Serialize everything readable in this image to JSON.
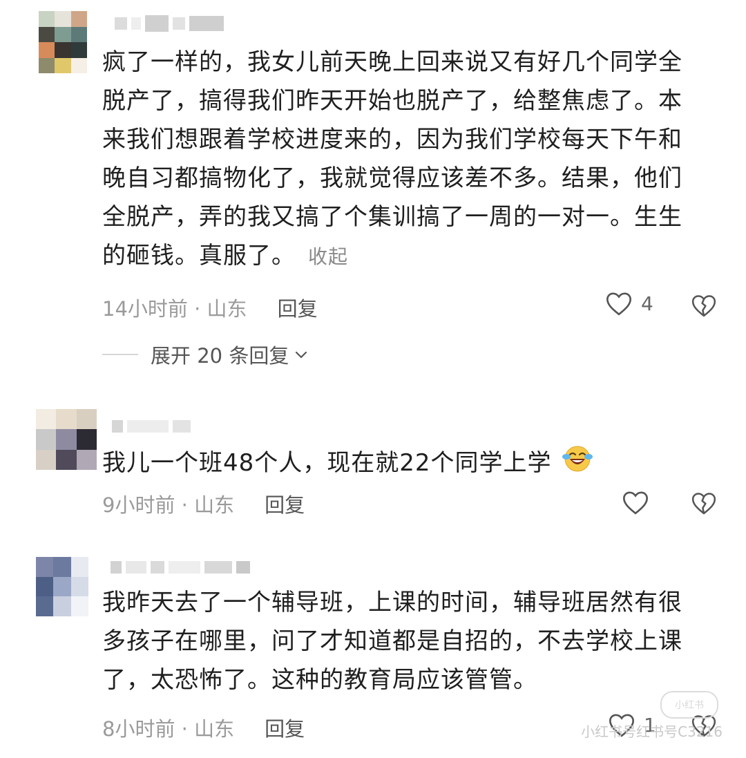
{
  "comments": [
    {
      "text": "疯了一样的，我女儿前天晚上回来说又有好几个同学全脱产了，搞得我们昨天开始也脱产了，给整焦虑了。本来我们想跟着学校进度来的，因为我们学校每天下午和晚自习都搞物化了，我就觉得应该差不多。结果，他们全脱产，弄的我又搞了个集训搞了一周的一对一。生生的砸钱。真服了。",
      "lines": [
        "疯了一样的，我女儿前天晚上回来说又有好几个同学全",
        "脱产了，搞得我们昨天开始也脱产了，给整焦虑了。本",
        "来我们想跟着学校进度来的，因为我们学校每天下午和",
        "晚自习都搞物化了，我就觉得应该差不多。结果，他们",
        "全脱产，弄的我又搞了个集训搞了一周的一对一。生生",
        "的砸钱。真服了。"
      ],
      "fold_label": "收起",
      "time": "14小时前",
      "location": "山东",
      "meta": "14小时前 · 山东",
      "reply_label": "回复",
      "likes": "4",
      "expand_label": "展开 20 条回复",
      "avatar_colors": [
        "#c9d3c3",
        "#e5e3da",
        "#cfa788",
        "#4a4a42",
        "#7f9c92",
        "#5d7a78",
        "#d88b5a",
        "#3a3431",
        "#2f3a3a",
        "#8e8a6c",
        "#e0c86a",
        "#f5efe5"
      ]
    },
    {
      "text": "我儿一个班48个人，现在就22个同学上学",
      "emoji": "laughing-crying-emoji",
      "time": "9小时前",
      "location": "山东",
      "meta": "9小时前 · 山东",
      "reply_label": "回复",
      "likes": "",
      "avatar_colors": [
        "#f2ece2",
        "#e7dccb",
        "#d9cfc0",
        "#c9c9c9",
        "#8e8aa0",
        "#2c2a33",
        "#d8d0c6",
        "#504a5b",
        "#b0a8b5"
      ]
    },
    {
      "text": "我昨天去了一个辅导班，上课的时间，辅导班居然有很多孩子在哪里，问了才知道都是自招的，不去学校上课了，太恐怖了。这种的教育局应该管管。",
      "lines": [
        "我昨天去了一个辅导班，上课的时间，辅导班居然有很",
        "多孩子在哪里，问了才知道都是自招的，不去学校上课",
        "了，太恐怖了。这种的教育局应该管管。"
      ],
      "time": "8小时前",
      "location": "山东",
      "meta": "8小时前 · 山东",
      "reply_label": "回复",
      "likes": "1",
      "avatar_colors": [
        "#7d86a8",
        "#6c7aa0",
        "#e8eaf2",
        "#4e5f86",
        "#9aa7c6",
        "#d6dbe8",
        "#5a6b90",
        "#c9cfde",
        "#f2f3f7"
      ]
    }
  ],
  "icons": {
    "like": "heart-outline-icon",
    "dislike": "broken-heart-icon",
    "expand": "chevron-down-icon"
  },
  "watermark": "小红书号红书号C3216",
  "watermark_logo": "小红书"
}
